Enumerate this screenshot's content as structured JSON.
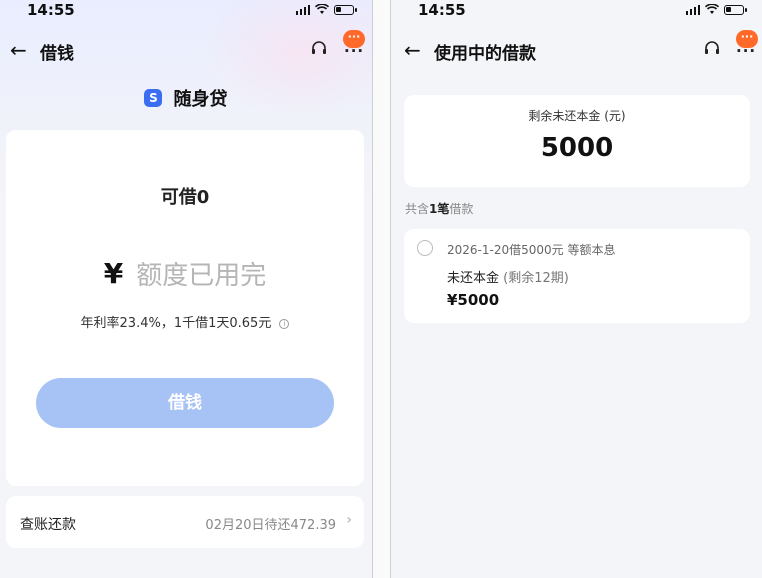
{
  "left": {
    "status_time": "14:55",
    "nav_title": "借钱",
    "badge": "···",
    "more": "···",
    "product_icon": "S",
    "product_name": "随身贷",
    "available_label": "可借0",
    "currency": "¥",
    "amount_text": "额度已用完",
    "rate_text": "年利率23.4%，1千借1天0.65元",
    "info_icon": "i",
    "borrow_button": "借钱",
    "bill_label": "查账还款",
    "bill_status": "02月20日待还472.39",
    "bill_chevron": "›"
  },
  "right": {
    "status_time": "14:55",
    "nav_title": "使用中的借款",
    "badge": "···",
    "more": "···",
    "summary_label": "剩余未还本金 (元)",
    "summary_value": "5000",
    "count_prefix": "共含",
    "count_number": "1笔",
    "count_suffix": "借款",
    "loan_desc": "2026-1-20借5000元   等额本息",
    "loan_label": "未还本金",
    "loan_sub": "(剩余12期)",
    "loan_amount": "¥5000"
  },
  "colors": {
    "primary_button_disabled": "#a7c2f5",
    "brand_icon": "#3a6df0",
    "badge": "#ff6a2b",
    "background": "#f4f5f8"
  },
  "icons": [
    "back-arrow-icon",
    "headset-icon",
    "more-icon",
    "info-icon",
    "chevron-right-icon",
    "radio-icon",
    "signal-icon",
    "wifi-icon",
    "battery-icon"
  ]
}
